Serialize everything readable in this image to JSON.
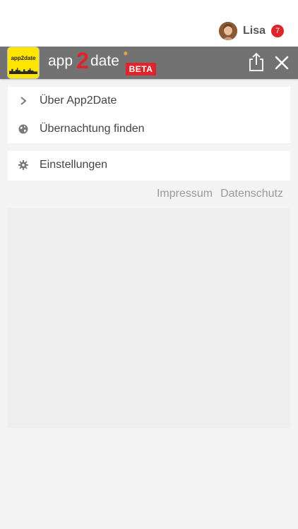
{
  "user": {
    "name": "Lisa",
    "notification_count": "7"
  },
  "header": {
    "logo_prefix": "app",
    "logo_digit": "2",
    "logo_suffix": "date",
    "beta_label": "BETA",
    "app_icon_text": "app2date"
  },
  "menu": {
    "items": [
      {
        "label": "Über App2Date",
        "icon": "chevron-right-icon"
      },
      {
        "label": "Übernachtung finden",
        "icon": "globe-icon"
      }
    ],
    "settings": {
      "label": "Einstellungen",
      "icon": "gear-icon"
    }
  },
  "footer": {
    "impressum": "Impressum",
    "datenschutz": "Datenschutz"
  },
  "colors": {
    "header_bg": "#727272",
    "accent_red": "#e0242b",
    "page_bg": "#f3f3f3",
    "card_bg": "#ffffff"
  }
}
